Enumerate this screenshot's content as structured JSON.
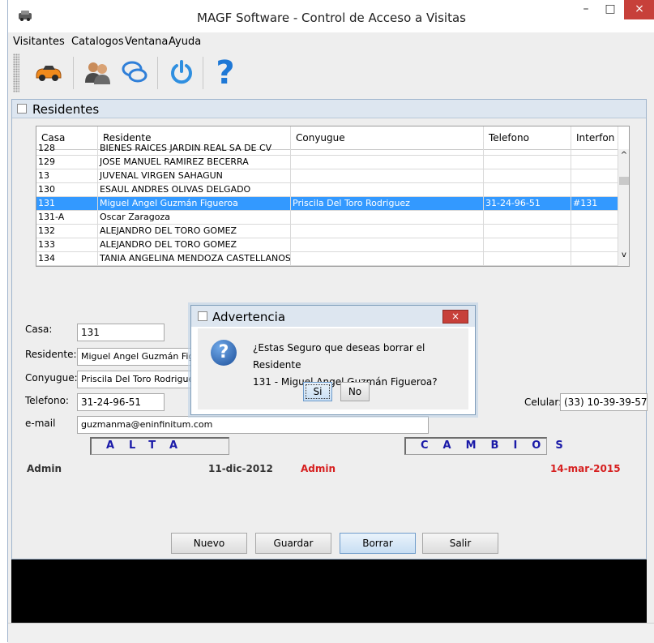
{
  "window": {
    "title": "MAGF Software - Control de Acceso a Visitas",
    "minimize": "–",
    "maximize": "□",
    "close": "×"
  },
  "menu": [
    "Visitantes",
    "Catalogos",
    "Ventana",
    "Ayuda"
  ],
  "toolbar": {
    "icons": [
      "car-icon",
      "people-icon",
      "chat-bubbles-icon",
      "power-icon",
      "help-icon"
    ],
    "help_glyph": "?"
  },
  "internal_frame": {
    "title": "Residentes"
  },
  "table": {
    "columns": [
      "Casa",
      "Residente",
      "Conyugue",
      "Telefono",
      "Interfon"
    ],
    "rows": [
      [
        "128",
        "BIENES RAICES JARDIN REAL SA DE CV",
        "",
        "",
        ""
      ],
      [
        "129",
        "JOSE MANUEL RAMIREZ BECERRA",
        "",
        "",
        ""
      ],
      [
        "13",
        "JUVENAL VIRGEN SAHAGUN",
        "",
        "",
        ""
      ],
      [
        "130",
        "ESAUL ANDRES OLIVAS DELGADO",
        "",
        "",
        ""
      ],
      [
        "131",
        "Miguel Angel Guzmán Figueroa",
        "Priscila Del Toro Rodriguez",
        "31-24-96-51",
        "#131"
      ],
      [
        "131-A",
        "Oscar Zaragoza",
        "",
        "",
        ""
      ],
      [
        "132",
        "ALEJANDRO DEL TORO GOMEZ",
        "",
        "",
        ""
      ],
      [
        "133",
        "ALEJANDRO DEL TORO GOMEZ",
        "",
        "",
        ""
      ],
      [
        "134",
        "TANIA ANGELINA MENDOZA CASTELLANOS",
        "",
        "",
        ""
      ]
    ],
    "selected_row": 4,
    "scroll_up": "^",
    "scroll_down": "v"
  },
  "form": {
    "casa_label": "Casa:",
    "casa_value": "131",
    "residente_label": "Residente:",
    "residente_value": "Miguel Angel Guzmán Figuer",
    "conyugue_label": "Conyugue:",
    "conyugue_value": "Priscila Del Toro Rodriguez",
    "telefono_label": "Telefono:",
    "telefono_value": "31-24-96-51",
    "celular_label": "Celular:",
    "celular_value": "(33) 10-39-39-57",
    "email_label": "e-mail",
    "email_value": "guzmanma@eninfinitum.com"
  },
  "sections": {
    "alta": "ALTA",
    "cambios": "CAMBIOS"
  },
  "audit": {
    "alta_user": "Admin",
    "alta_date": "11-dic-2012",
    "cambios_user": "Admin",
    "cambios_date": "14-mar-2015"
  },
  "buttons": {
    "nuevo": "Nuevo",
    "guardar": "Guardar",
    "borrar": "Borrar",
    "salir": "Salir"
  },
  "dialog": {
    "title": "Advertencia",
    "line1": "¿Estas Seguro que deseas borrar el Residente",
    "line2": "131 - Miguel Angel Guzmán Figueroa?",
    "icon_glyph": "?",
    "close": "×",
    "yes": "Si",
    "no": "No"
  },
  "colors": {
    "selection": "#3399ff",
    "section_text": "#1a1aa8",
    "cambios_red": "#d62020",
    "close_red": "#c7403a"
  }
}
